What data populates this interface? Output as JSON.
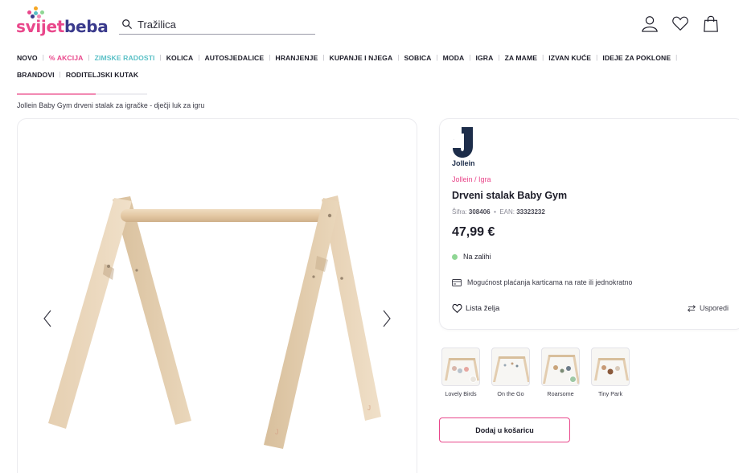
{
  "brand": {
    "logo_text_part1": "svijet",
    "logo_text_part2": "beba",
    "dot_colors": [
      "#f5a623",
      "#e9478b",
      "#59c0c6",
      "#8fd694",
      "#3a3a8c",
      "#f28ab3"
    ]
  },
  "search": {
    "placeholder": "Tražilica",
    "icon": "search-icon"
  },
  "header_icons": [
    "user-icon",
    "heart-icon",
    "bag-icon"
  ],
  "nav": {
    "row1": [
      {
        "label": "NOVO",
        "color": "default"
      },
      {
        "label": "% AKCIJA",
        "color": "pink"
      },
      {
        "label": "ZIMSKE RADOSTI",
        "color": "teal"
      },
      {
        "label": "KOLICA",
        "color": "default"
      },
      {
        "label": "AUTOSJEDALICE",
        "color": "default"
      },
      {
        "label": "HRANJENJE",
        "color": "default"
      },
      {
        "label": "KUPANJE I NJEGA",
        "color": "default"
      },
      {
        "label": "SOBICA",
        "color": "default"
      },
      {
        "label": "MODA",
        "color": "default"
      },
      {
        "label": "IGRA",
        "color": "default"
      },
      {
        "label": "ZA MAME",
        "color": "default"
      },
      {
        "label": "IZVAN KUĆE",
        "color": "default"
      },
      {
        "label": "IDEJE ZA POKLONE",
        "color": "default"
      }
    ],
    "row2": [
      {
        "label": "BRANDOVI",
        "color": "default"
      },
      {
        "label": "RODITELJSKI KUTAK",
        "color": "default"
      }
    ]
  },
  "breadcrumb": "Jollein Baby Gym drveni stalak za igračke - dječji luk za igru",
  "product": {
    "brand_letter": "J",
    "brand_name": "Jollein",
    "category_path": "Jollein / Igra",
    "title": "Drveni stalak Baby Gym",
    "sku_label": "Šifra:",
    "sku": "308406",
    "bullet": "•",
    "ean_label": "EAN:",
    "ean": "33323232",
    "price": "47,99 €",
    "stock": "Na zalihi",
    "payment_info": "Mogućnost plaćanja karticama na rate ili jednokratno",
    "wishlist": "Lista želja",
    "compare": "Usporedi",
    "add_to_cart": "Dodaj u košaricu"
  },
  "variants": [
    {
      "label": "Lovely Birds",
      "swatch": "#e9e5de"
    },
    {
      "label": "On the Go",
      "swatch": ""
    },
    {
      "label": "Roarsome",
      "swatch": "#9ec8a5"
    },
    {
      "label": "Tiny Park",
      "swatch": ""
    }
  ],
  "colors": {
    "accent_pink": "#e9478b",
    "accent_teal": "#59c0c6",
    "stock_green": "#8fd694",
    "wood": "#e8d4b8"
  }
}
